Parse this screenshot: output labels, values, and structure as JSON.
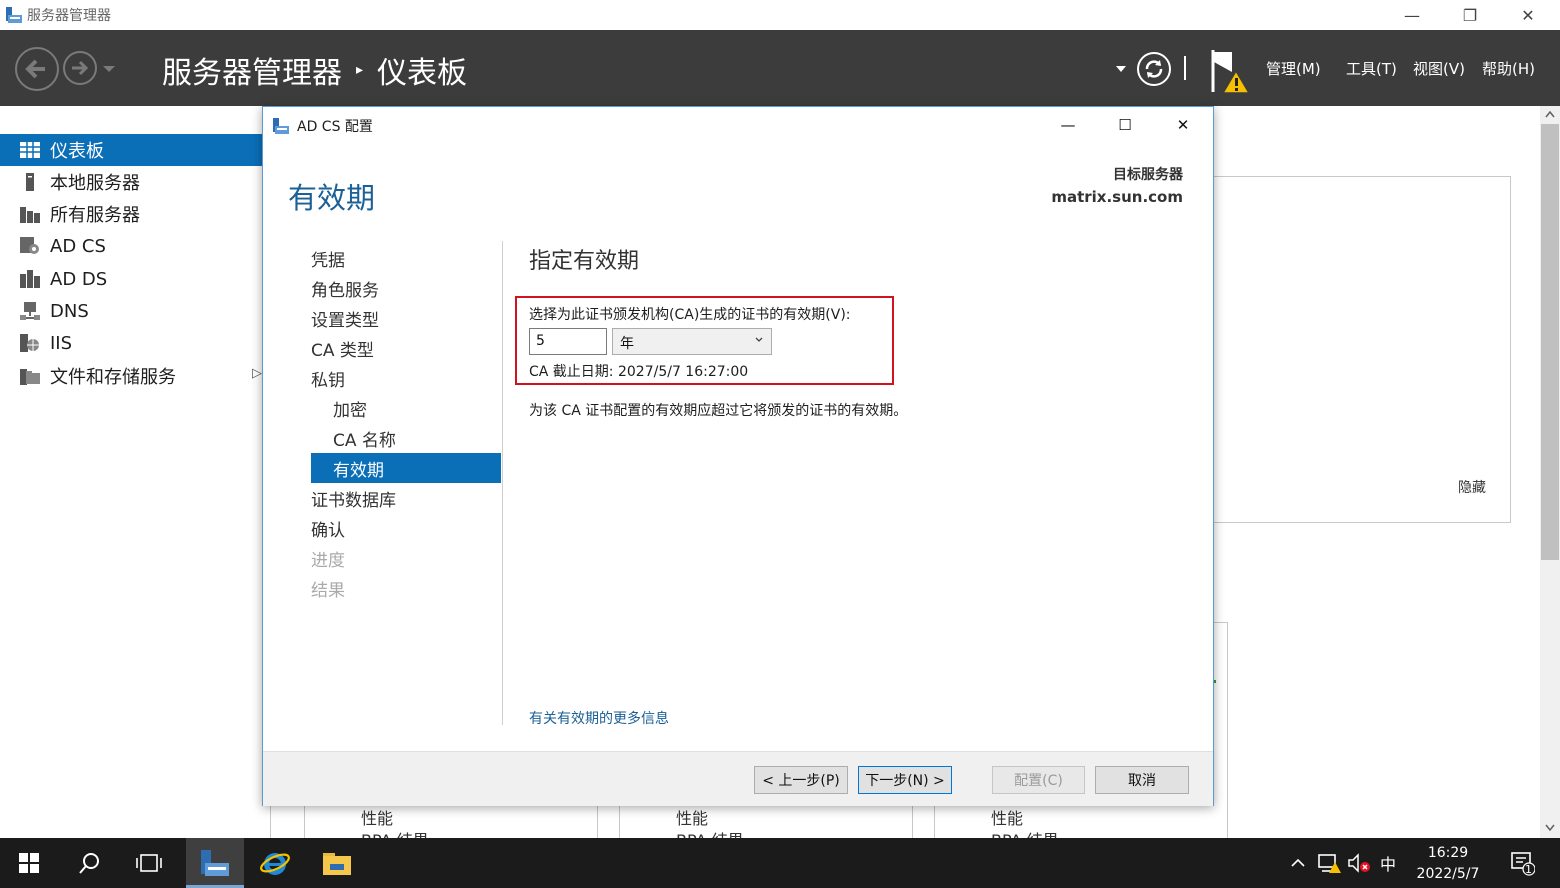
{
  "window": {
    "title": "服务器管理器",
    "minimize": "—",
    "maximize": "❐",
    "close": "✕"
  },
  "header": {
    "crumb_root": "服务器管理器",
    "crumb_sep": "▸",
    "crumb_current": "仪表板",
    "menu_manage": "管理(M)",
    "menu_tools": "工具(T)",
    "menu_view": "视图(V)",
    "menu_help": "帮助(H)"
  },
  "nav": {
    "items": [
      {
        "label": "仪表板",
        "icon": "dashboard-icon"
      },
      {
        "label": "本地服务器",
        "icon": "local-server-icon"
      },
      {
        "label": "所有服务器",
        "icon": "all-servers-icon"
      },
      {
        "label": "AD CS",
        "icon": "adcs-icon"
      },
      {
        "label": "AD DS",
        "icon": "adds-icon"
      },
      {
        "label": "DNS",
        "icon": "dns-icon"
      },
      {
        "label": "IIS",
        "icon": "iis-icon"
      },
      {
        "label": "文件和存储服务",
        "icon": "file-storage-icon"
      }
    ],
    "expand_arrow": "▷"
  },
  "background": {
    "hide_label": "隐藏",
    "tile_perf": "性能",
    "tile_bpa": "BPA 结果"
  },
  "dialog": {
    "title": "AD CS 配置",
    "min": "—",
    "max": "☐",
    "close": "✕",
    "page_title": "有效期",
    "target_label": "目标服务器",
    "target_value": "matrix.sun.com",
    "steps": [
      {
        "label": "凭据",
        "state": "normal",
        "level": 0
      },
      {
        "label": "角色服务",
        "state": "normal",
        "level": 0
      },
      {
        "label": "设置类型",
        "state": "normal",
        "level": 0
      },
      {
        "label": "CA 类型",
        "state": "normal",
        "level": 0
      },
      {
        "label": "私钥",
        "state": "normal",
        "level": 0
      },
      {
        "label": "加密",
        "state": "normal",
        "level": 1
      },
      {
        "label": "CA 名称",
        "state": "normal",
        "level": 1
      },
      {
        "label": "有效期",
        "state": "active",
        "level": 1
      },
      {
        "label": "证书数据库",
        "state": "normal",
        "level": 0
      },
      {
        "label": "确认",
        "state": "normal",
        "level": 0
      },
      {
        "label": "进度",
        "state": "disabled",
        "level": 0
      },
      {
        "label": "结果",
        "state": "disabled",
        "level": 0
      }
    ],
    "section_title": "指定有效期",
    "validity_label": "选择为此证书颁发机构(CA)生成的证书的有效期(V):",
    "validity_value": "5",
    "validity_unit": "年",
    "expiry": "CA 截止日期: 2027/5/7 16:27:00",
    "note": "为该 CA 证书配置的有效期应超过它将颁发的证书的有效期。",
    "more_info": "有关有效期的更多信息",
    "btn_prev": "< 上一步(P)",
    "btn_next": "下一步(N) >",
    "btn_config": "配置(C)",
    "btn_cancel": "取消"
  },
  "taskbar": {
    "clock_time": "16:29",
    "clock_date": "2022/5/7",
    "ime": "中",
    "notif_count": "1"
  },
  "colors": {
    "accent": "#0b6fb8",
    "header_bg": "#3c3c3c",
    "title_blue": "#1b6096",
    "highlight_red": "#d0131e"
  }
}
